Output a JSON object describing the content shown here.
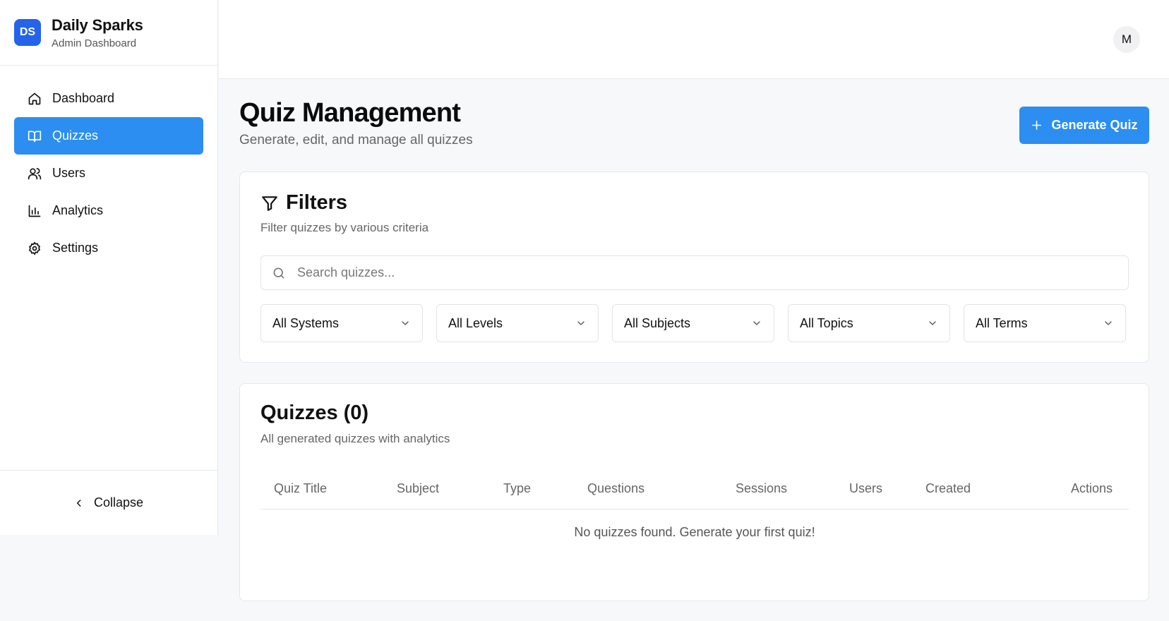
{
  "brand": {
    "logo_text": "DS",
    "name": "Daily Sparks",
    "subtitle": "Admin Dashboard"
  },
  "sidebar": {
    "items": [
      {
        "label": "Dashboard",
        "icon": "home-icon",
        "active": false
      },
      {
        "label": "Quizzes",
        "icon": "book-open-icon",
        "active": true
      },
      {
        "label": "Users",
        "icon": "users-icon",
        "active": false
      },
      {
        "label": "Analytics",
        "icon": "bar-chart-icon",
        "active": false
      },
      {
        "label": "Settings",
        "icon": "gear-icon",
        "active": false
      }
    ],
    "collapse_label": "Collapse"
  },
  "header": {
    "avatar_initial": "M"
  },
  "page": {
    "title": "Quiz Management",
    "subtitle": "Generate, edit, and manage all quizzes",
    "generate_button": "Generate Quiz"
  },
  "filters": {
    "title": "Filters",
    "subtitle": "Filter quizzes by various criteria",
    "search_placeholder": "Search quizzes...",
    "selects": [
      "All Systems",
      "All Levels",
      "All Subjects",
      "All Topics",
      "All Terms"
    ]
  },
  "quizzes": {
    "title": "Quizzes (0)",
    "subtitle": "All generated quizzes with analytics",
    "columns": [
      "Quiz Title",
      "Subject",
      "Type",
      "Questions",
      "Sessions",
      "Users",
      "Created",
      "Actions"
    ],
    "empty_message": "No quizzes found. Generate your first quiz!"
  },
  "colors": {
    "accent": "#2b8ef0",
    "logo_bg": "#2563eb"
  }
}
